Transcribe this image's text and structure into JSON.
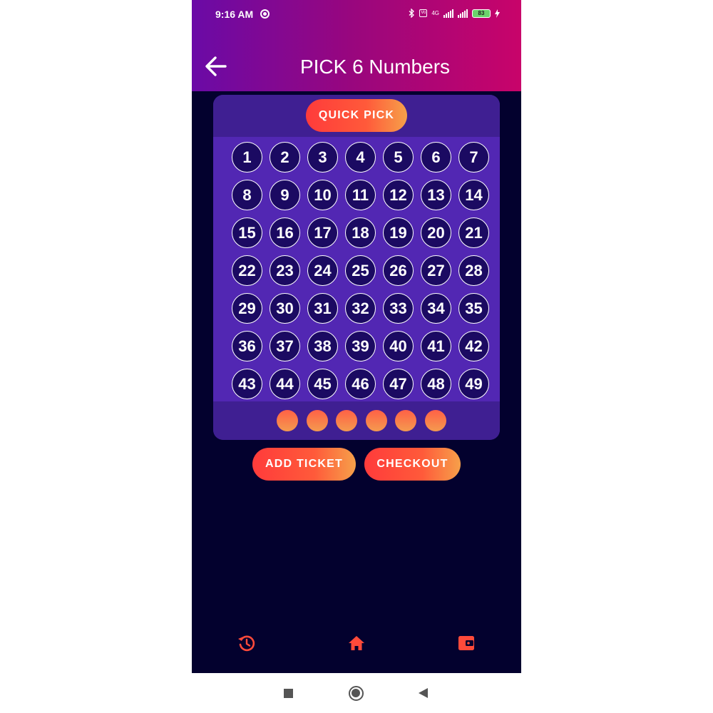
{
  "status_bar": {
    "time": "9:16 AM",
    "net_label": "4G",
    "battery": "83"
  },
  "header": {
    "title": "PICK 6 Numbers"
  },
  "quick_pick_label": "QUICK PICK",
  "numbers": [
    "1",
    "2",
    "3",
    "4",
    "5",
    "6",
    "7",
    "8",
    "9",
    "10",
    "11",
    "12",
    "13",
    "14",
    "15",
    "16",
    "17",
    "18",
    "19",
    "20",
    "21",
    "22",
    "23",
    "24",
    "25",
    "26",
    "27",
    "28",
    "29",
    "30",
    "31",
    "32",
    "33",
    "34",
    "35",
    "36",
    "37",
    "38",
    "39",
    "40",
    "41",
    "42",
    "43",
    "44",
    "45",
    "46",
    "47",
    "48",
    "49"
  ],
  "selected_slots": 6,
  "buttons": {
    "add_ticket": "ADD TICKET",
    "checkout": "CHECKOUT"
  },
  "bottom_nav": [
    {
      "icon": "history-icon"
    },
    {
      "icon": "home-icon"
    },
    {
      "icon": "wallet-icon"
    }
  ],
  "colors": {
    "background": "#03012e",
    "card": "#3a1c8f",
    "grid": "#5227b3",
    "accent": "#ff4a3a",
    "accent_end": "#f6a04a"
  }
}
